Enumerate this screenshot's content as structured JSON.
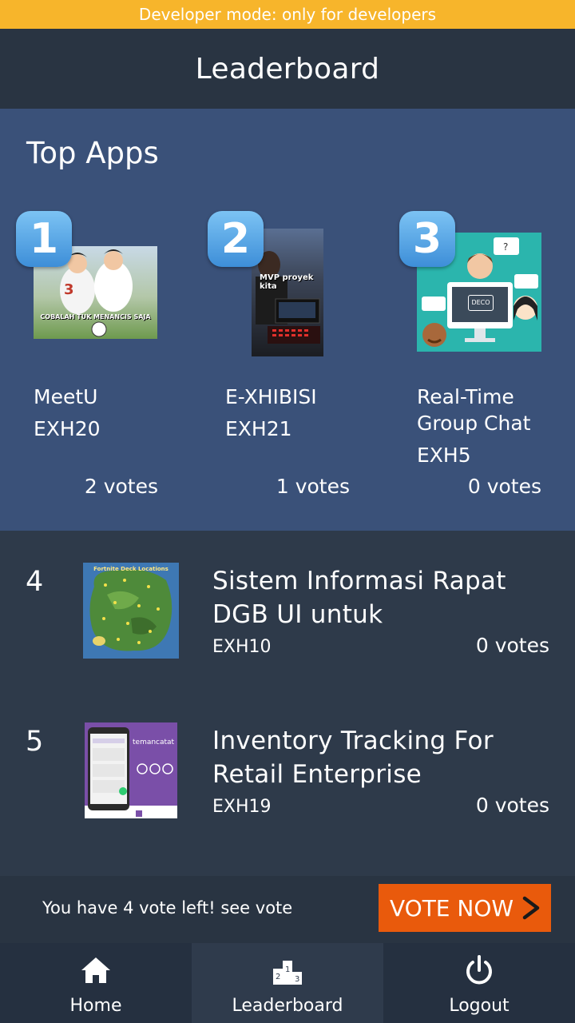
{
  "dev_banner": "Developer mode: only for developers",
  "header": {
    "title": "Leaderboard"
  },
  "top_apps": {
    "title": "Top Apps",
    "items": [
      {
        "rank": "1",
        "name": "MeetU",
        "code": "EXH20",
        "votes": "2 votes",
        "thumb_caption": "COBALAH TUK MENANCIS SAJA"
      },
      {
        "rank": "2",
        "name": "E-XHIBISI",
        "code": "EXH21",
        "votes": "1 votes",
        "thumb_caption": "MVP proyek kita"
      },
      {
        "rank": "3",
        "name": "Real-Time Group Chat",
        "code": "EXH5",
        "votes": "0 votes",
        "thumb_caption": "DECO"
      }
    ]
  },
  "list": [
    {
      "rank": "4",
      "name": "Sistem Informasi Rapat DGB UI untuk",
      "code": "EXH10",
      "votes": "0 votes",
      "thumb_caption": "Fortnite Deck Locations"
    },
    {
      "rank": "5",
      "name": "Inventory Tracking For Retail Enterprise",
      "code": "EXH19",
      "votes": "0 votes",
      "thumb_caption": "temancatat"
    }
  ],
  "vote_bar": {
    "message": "You have 4 vote left! see vote",
    "button": "VOTE NOW"
  },
  "nav": [
    {
      "label": "Home",
      "icon": "home-icon"
    },
    {
      "label": "Leaderboard",
      "icon": "podium-icon"
    },
    {
      "label": "Logout",
      "icon": "power-icon"
    }
  ],
  "colors": {
    "accent": "#e95a0c",
    "banner": "#f7b52b",
    "top_bg": "#3a5179",
    "bg": "#2e3a4a"
  }
}
